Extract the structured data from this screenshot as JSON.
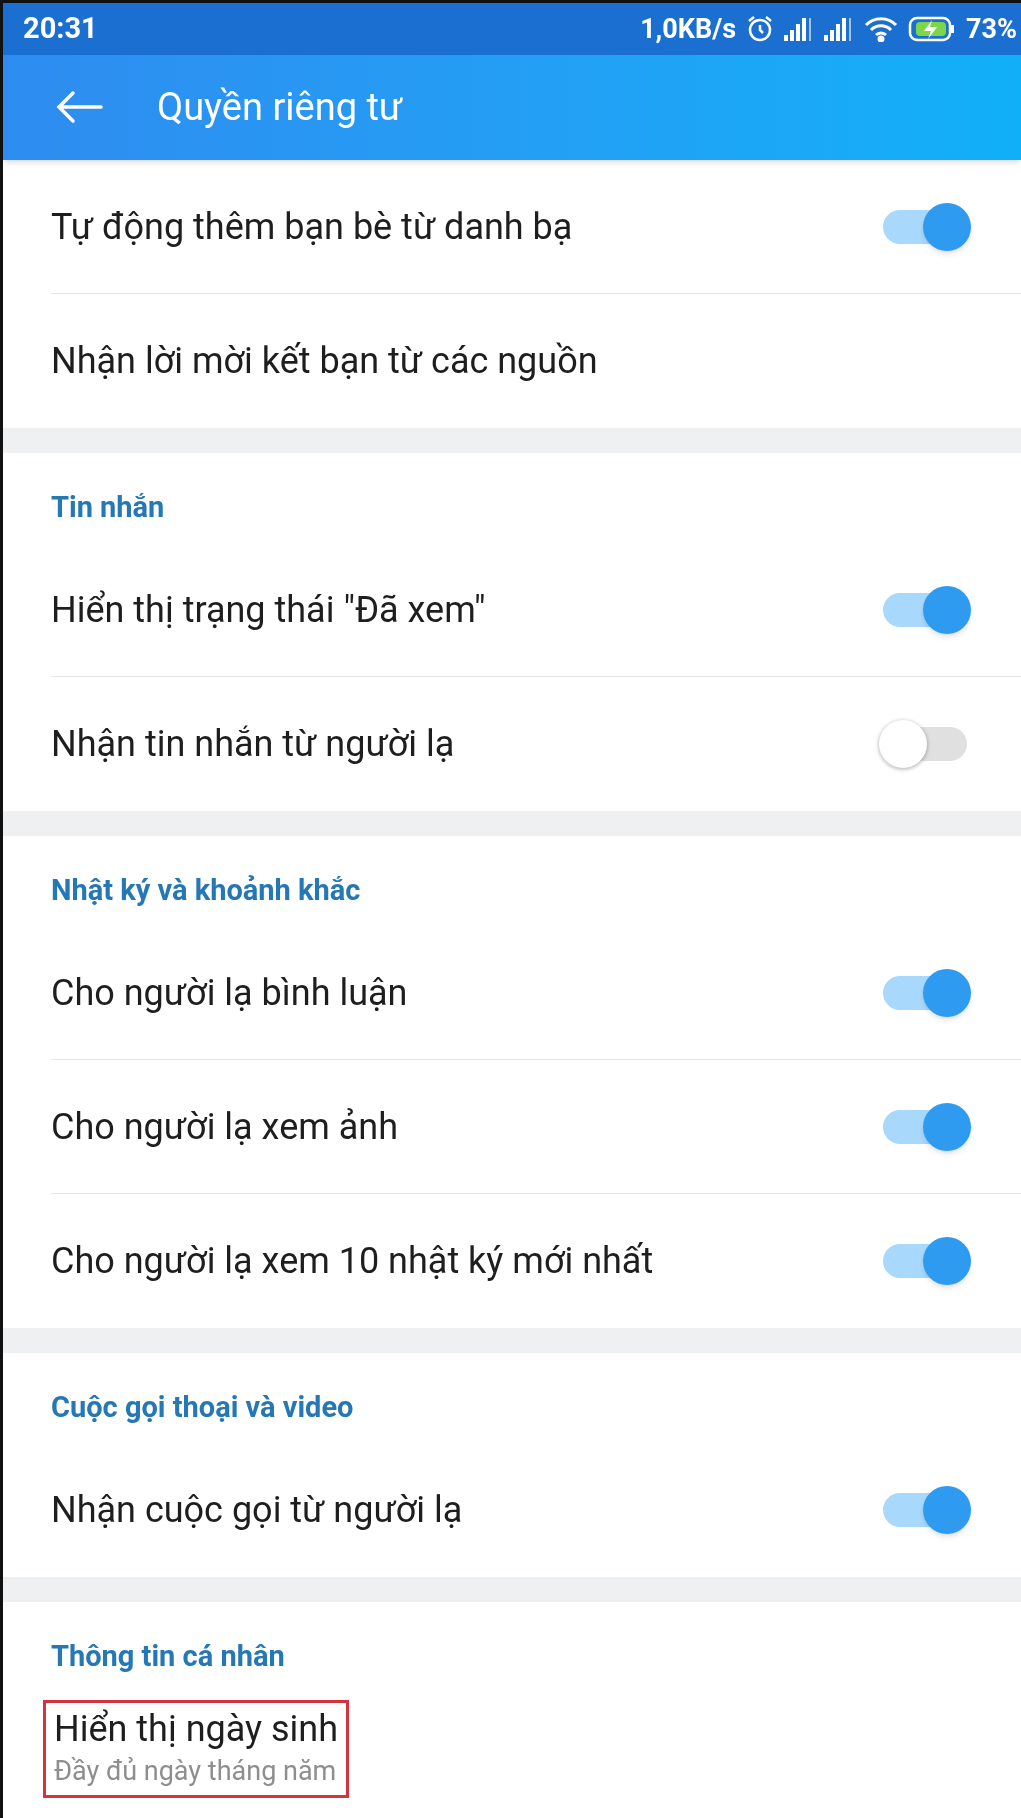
{
  "status_bar": {
    "time": "20:31",
    "speed": "1,0KB/s",
    "battery": "73%"
  },
  "header": {
    "title": "Quyền riêng tư"
  },
  "sections": [
    {
      "items": [
        {
          "kind": "toggle",
          "label": "Tự động thêm bạn bè từ danh bạ",
          "on": true
        },
        {
          "kind": "plain",
          "label": "Nhận lời mời kết bạn từ các nguồn"
        }
      ]
    },
    {
      "title": "Tin nhắn",
      "items": [
        {
          "kind": "toggle",
          "label": "Hiển thị trạng thái \"Đã xem\"",
          "on": true
        },
        {
          "kind": "toggle",
          "label": "Nhận tin nhắn từ người lạ",
          "on": false
        }
      ]
    },
    {
      "title": "Nhật ký và khoảnh khắc",
      "items": [
        {
          "kind": "toggle",
          "label": "Cho người lạ bình luận",
          "on": true
        },
        {
          "kind": "toggle",
          "label": "Cho người lạ xem ảnh",
          "on": true
        },
        {
          "kind": "toggle",
          "label": "Cho người lạ xem 10 nhật ký mới nhất",
          "on": true
        }
      ]
    },
    {
      "title": "Cuộc gọi thoại và video",
      "items": [
        {
          "kind": "toggle",
          "label": "Nhận cuộc gọi từ người lạ",
          "on": true
        }
      ]
    },
    {
      "title": "Thông tin cá nhân",
      "items": [
        {
          "kind": "detail",
          "label": "Hiển thị ngày sinh",
          "value": "Đầy đủ ngày tháng năm",
          "highlighted": true
        }
      ]
    }
  ]
}
